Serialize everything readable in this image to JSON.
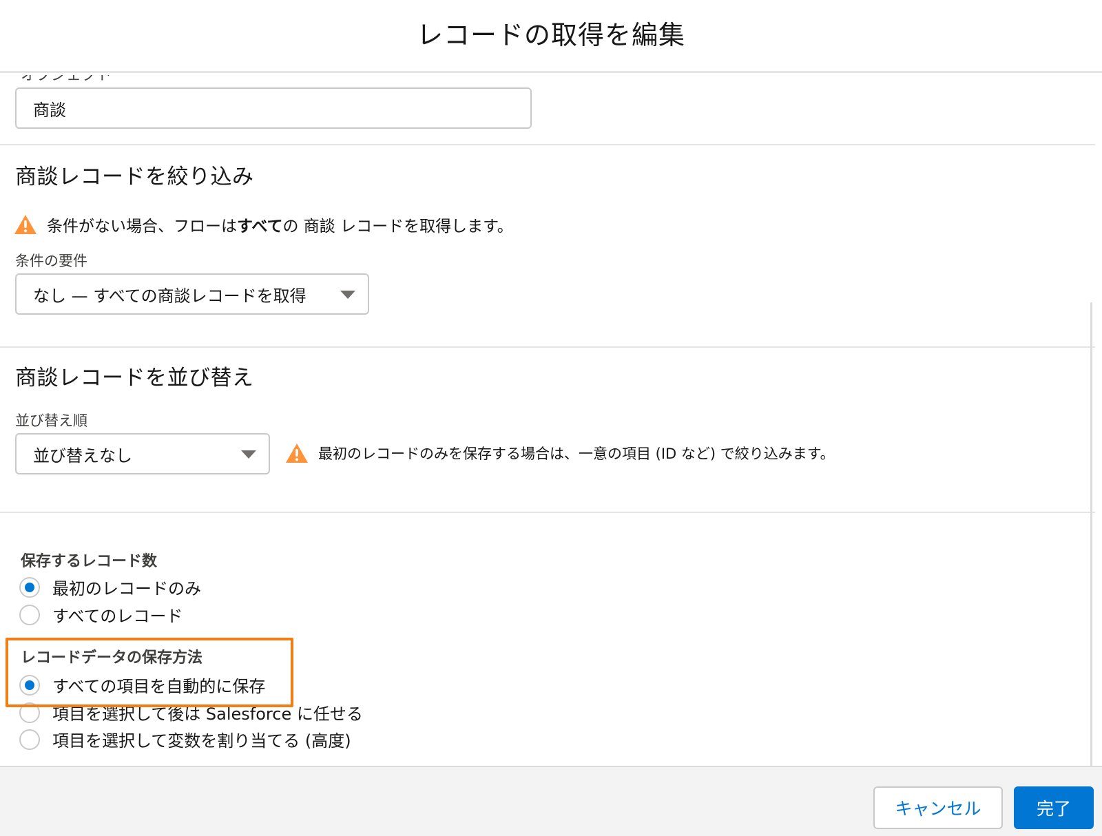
{
  "modal": {
    "title": "レコードの取得を編集"
  },
  "object_section": {
    "label_partial": "オブジェクト",
    "value": "商談"
  },
  "filter_section": {
    "title": "商談レコードを絞り込み",
    "warning_before": "条件がない場合、フローは",
    "warning_bold": "すべて",
    "warning_after": "の 商談 レコードを取得します。",
    "condition_label": "条件の要件",
    "condition_value": "なし — すべての商談レコードを取得"
  },
  "sort_section": {
    "title": "商談レコードを並び替え",
    "order_label": "並び替え順",
    "order_value": "並び替えなし",
    "warning": "最初のレコードのみを保存する場合は、一意の項目 (ID など) で絞り込みます。"
  },
  "store_section": {
    "count_label": "保存するレコード数",
    "count_options": [
      "最初のレコードのみ",
      "すべてのレコード"
    ],
    "count_selected": 0,
    "method_label": "レコードデータの保存方法",
    "method_options": [
      "すべての項目を自動的に保存",
      "項目を選択して後は Salesforce に任せる",
      "項目を選択して変数を割り当てる (高度)"
    ],
    "method_selected": 0
  },
  "footer": {
    "cancel_label": "キャンセル",
    "done_label": "完了"
  },
  "colors": {
    "accent": "#0176d3",
    "warning": "#fe9339",
    "highlight": "#f07e14"
  },
  "icons": {
    "warning": "warning-icon",
    "caret": "chevron-down-icon"
  }
}
